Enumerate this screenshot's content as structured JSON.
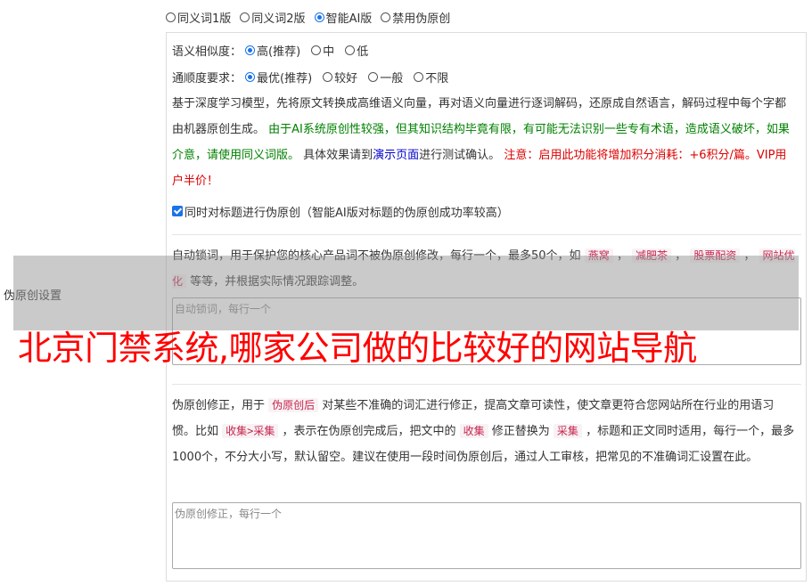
{
  "top_options": [
    {
      "label": "同义词1版",
      "checked": false
    },
    {
      "label": "同义词2版",
      "checked": false
    },
    {
      "label": "智能AI版",
      "checked": true
    },
    {
      "label": "禁用伪原创",
      "checked": false
    }
  ],
  "side_label": "伪原创设置",
  "similarity": {
    "label": "语义相似度：",
    "options": [
      {
        "label": "高(推荐)",
        "checked": true
      },
      {
        "label": "中",
        "checked": false
      },
      {
        "label": "低",
        "checked": false
      }
    ]
  },
  "fluency": {
    "label": "通顺度要求：",
    "options": [
      {
        "label": "最优(推荐)",
        "checked": true
      },
      {
        "label": "较好",
        "checked": false
      },
      {
        "label": "一般",
        "checked": false
      },
      {
        "label": "不限",
        "checked": false
      }
    ]
  },
  "description": {
    "p1": "基于深度学习模型，先将原文转换成高维语义向量，再对语义向量进行逐词解码，还原成自然语言，解码过程中每个字都由机器原创生成。 ",
    "p2_green": "由于AI系统原创性较强，但其知识结构毕竟有限，有可能无法识别一些专有术语，造成语义破坏，如果介意，请使用同义词版。",
    "p3": " 具体效果请到",
    "p4_link": "演示页面",
    "p5": "进行测试确认。 ",
    "p6_red": "注意：启用此功能将增加积分消耗：+6积分/篇。VIP用户半价！"
  },
  "title_checkbox": {
    "label": "同时对标题进行伪原创（智能AI版对标题的伪原创成功率较高）",
    "checked": true
  },
  "lock_words": {
    "desc_a": "自动锁词，用于保护您的核心产品词不被伪原创修改，每行一个，最多50个，如 ",
    "examples": [
      "燕窝",
      "减肥茶",
      "股票配资",
      "网站优化"
    ],
    "desc_b": " 等等，并根据实际情况跟踪调整。",
    "placeholder": "自动锁词，每行一个"
  },
  "correction": {
    "t1": "伪原创修正，用于 ",
    "chip1": "伪原创后",
    "t2": " 对某些不准确的词汇进行修正，提高文章可读性，使文章更符合您网站所在行业的用语习惯。比如 ",
    "chip2": "收集>采集",
    "t3": " ，表示在伪原创完成后，把文中的 ",
    "chip3": "收集",
    "t4": " 修正替换为 ",
    "chip4": "采集",
    "t5": " ，标题和正文同时适用，每行一个，最多1000个，不分大小写，默认留空。建议在使用一段时间伪原创后，通过人工审核，把常见的不准确词汇设置在此。",
    "placeholder": "伪原创修正，每行一个"
  },
  "banner_text": "北京门禁系统,哪家公司做的比较好的网站导航"
}
